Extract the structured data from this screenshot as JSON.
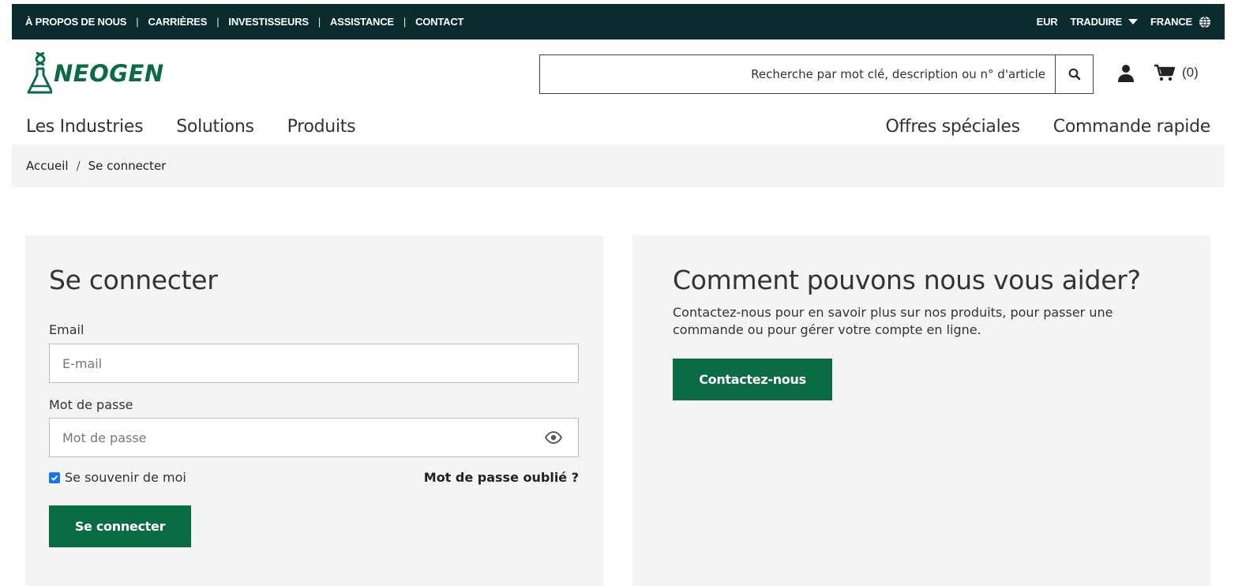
{
  "topbar": {
    "links": [
      "À PROPOS DE NOUS",
      "CARRIÈRES",
      "INVESTISSEURS",
      "ASSISTANCE",
      "CONTACT"
    ],
    "currency": "EUR",
    "translate": "TRADUIRE",
    "country": "FRANCE"
  },
  "header": {
    "logo_text": "NEOGEN",
    "search_placeholder": "Recherche par mot clé, description ou n° d'article",
    "cart_count": "(0)"
  },
  "nav": {
    "left": [
      "Les Industries",
      "Solutions",
      "Produits"
    ],
    "right": [
      "Offres spéciales",
      "Commande rapide"
    ]
  },
  "breadcrumb": {
    "home": "Accueil",
    "separator": "/",
    "current": "Se connecter"
  },
  "login": {
    "title": "Se connecter",
    "email_label": "Email",
    "email_placeholder": "E-mail",
    "password_label": "Mot de passe",
    "password_placeholder": "Mot de passe",
    "remember_label": "Se souvenir de moi",
    "remember_checked": true,
    "forgot_label": "Mot de passe oublié ?",
    "submit_label": "Se connecter"
  },
  "help": {
    "title": "Comment pouvons nous vous aider?",
    "text": "Contactez-nous pour en savoir plus sur nos produits, pour passer une commande ou pour gérer votre compte en ligne.",
    "button_label": "Contactez-nous"
  },
  "colors": {
    "topbar_bg": "#0b2b2e",
    "brand_green": "#0b6b45",
    "panel_bg": "#f4f4f4"
  }
}
